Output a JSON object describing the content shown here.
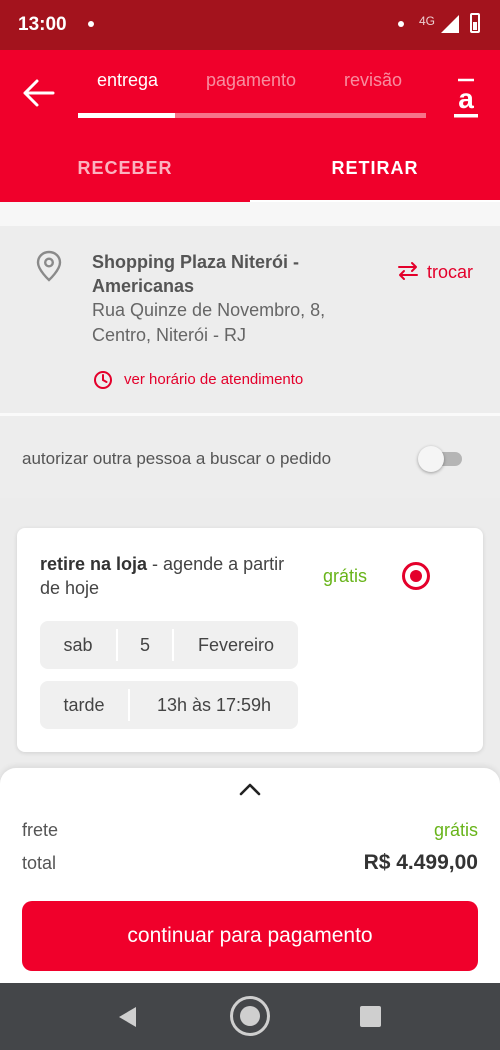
{
  "status_bar": {
    "time": "13:00",
    "network": "4G",
    "icons": [
      "notification-dot-icon",
      "signal-icon",
      "battery-icon"
    ]
  },
  "header": {
    "back_icon": "arrow-left-icon",
    "brand_icon": "americanas-logo-icon",
    "steps": [
      {
        "label": "entrega",
        "active": true
      },
      {
        "label": "pagamento",
        "active": false
      },
      {
        "label": "revisão",
        "active": false
      }
    ],
    "progress": 0.28,
    "tabs": [
      {
        "label": "RECEBER",
        "selected": false
      },
      {
        "label": "RETIRAR",
        "selected": true
      }
    ]
  },
  "store": {
    "icon": "location-pin-icon",
    "name": "Shopping Plaza Niterói - Americanas",
    "address": "Rua Quinze de Novembro, 8, Centro, Niterói - RJ",
    "change_label": "trocar",
    "change_icon": "swap-arrows-icon",
    "hours_label": "ver horário de atendimento",
    "hours_icon": "clock-icon"
  },
  "authorize": {
    "label": "autorizar outra pessoa a buscar o pedido",
    "enabled": false
  },
  "pickup_option": {
    "title_bold": "retire na loja",
    "title_rest": " - agende a partir de hoje",
    "price": "grátis",
    "selected": true,
    "date": {
      "weekday": "sab",
      "day": "5",
      "month": "Fevereiro"
    },
    "time": {
      "period": "tarde",
      "range": "13h às 17:59h"
    }
  },
  "summary": {
    "expand_icon": "chevron-up-icon",
    "frete_label": "frete",
    "frete_value": "grátis",
    "total_label": "total",
    "total_value": "R$ 4.499,00",
    "cta_label": "continuar para pagamento"
  },
  "colors": {
    "brand_red": "#f0002b",
    "status_bar": "#a3131d",
    "green": "#68b41a",
    "nav_bar": "#444649"
  }
}
